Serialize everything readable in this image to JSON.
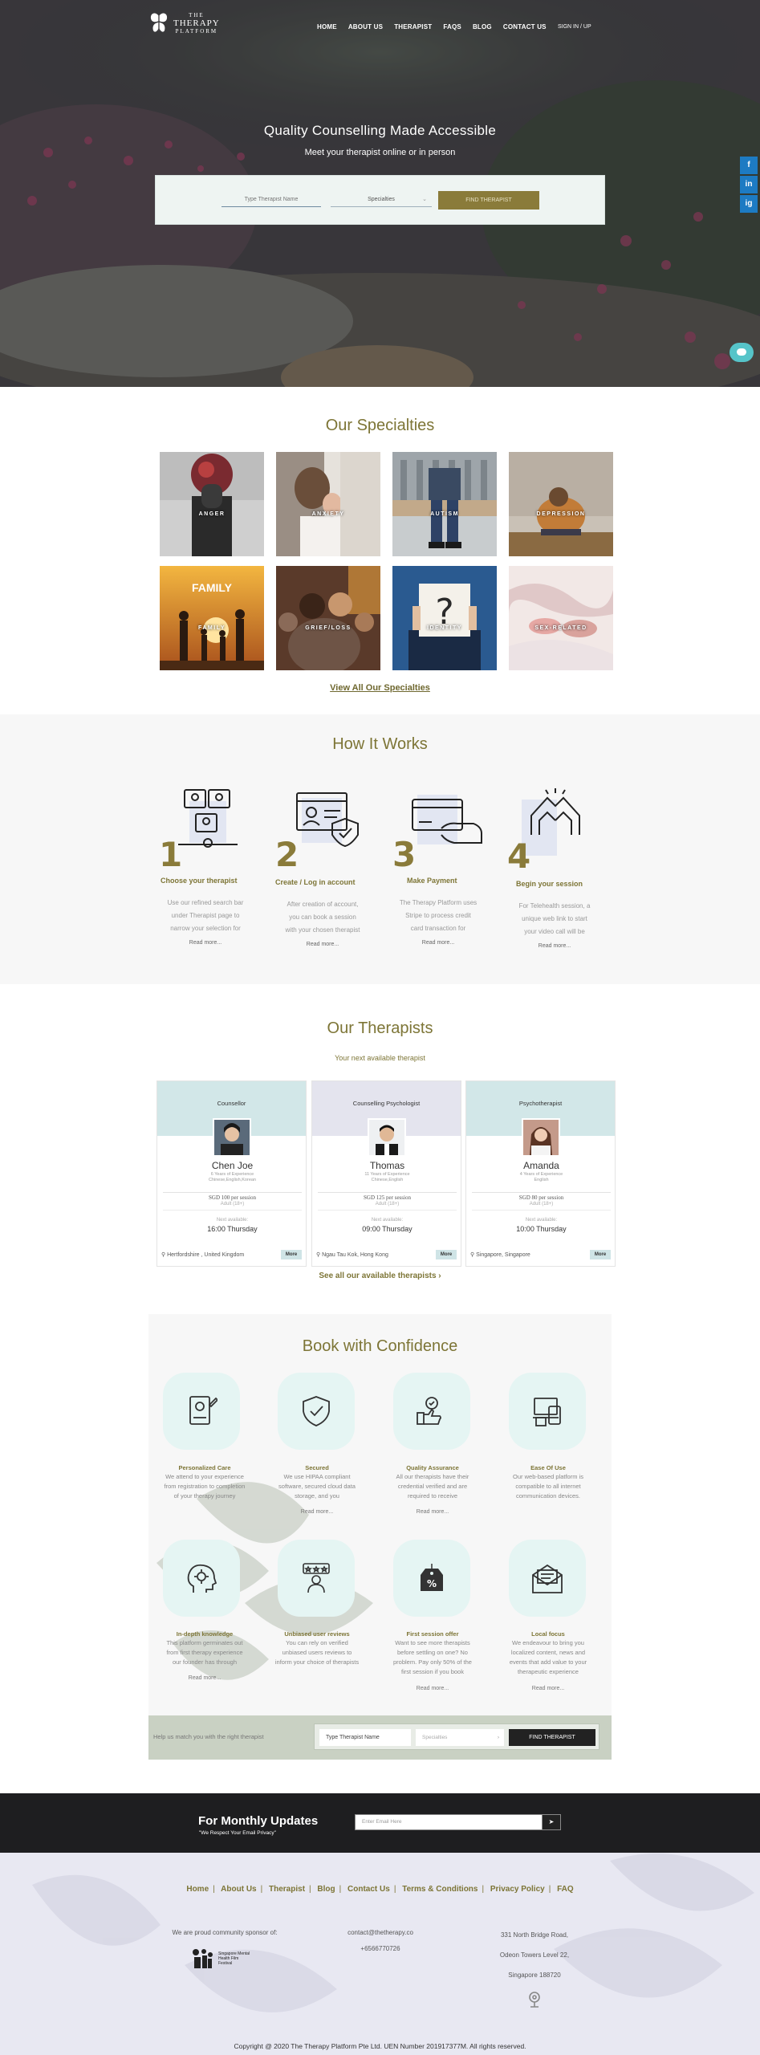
{
  "nav": {
    "logo_small": "THE",
    "logo_big": "THERAPY",
    "logo_sub": "PLATFORM",
    "links": [
      "HOME",
      "ABOUT US",
      "THERAPIST",
      "FAQS",
      "BLOG",
      "CONTACT US"
    ],
    "sign_in": "SIGN IN / UP"
  },
  "hero": {
    "title": "Quality Counselling Made Accessible",
    "subtitle": "Meet your therapist online or in person",
    "search_placeholder": "Type Therapist Name",
    "select_value": "Specialties",
    "button": "FIND THERAPIST"
  },
  "social": [
    "f",
    "in",
    "ig"
  ],
  "specialties": {
    "title": "Our Specialties",
    "items": [
      "ANGER",
      "ANXIETY",
      "AUTISM",
      "DEPRESSION",
      "FAMILY",
      "GRIEF/LOSS",
      "IDENTITY",
      "SEX-RELATED"
    ],
    "family_sign": "FAMILY",
    "view_all": "View All Our Specialties"
  },
  "how": {
    "title": "How It Works",
    "steps": [
      {
        "num": "1",
        "title": "Choose your therapist",
        "lines": [
          "Use our refined search bar",
          "under Therapist page to",
          "narrow your selection for"
        ],
        "more": "Read more..."
      },
      {
        "num": "2",
        "title": "Create / Log in account",
        "lines": [
          "After creation of account,",
          "you can book a session",
          "with your chosen therapist"
        ],
        "more": "Read more..."
      },
      {
        "num": "3",
        "title": "Make Payment",
        "lines": [
          "The Therapy Platform uses",
          "Stripe to process credit",
          "card transaction for"
        ],
        "more": "Read more..."
      },
      {
        "num": "4",
        "title": "Begin your session",
        "lines": [
          "For Telehealth session, a",
          "unique web link to start",
          "your video call will be"
        ],
        "more": "Read more..."
      }
    ]
  },
  "therapists": {
    "title": "Our Therapists",
    "subtitle": "Your next available therapist",
    "cards": [
      {
        "role": "Counsellor",
        "name": "Chen Joe",
        "exp": "6 Years of Experience",
        "lang": "Chinese,English,Korean",
        "price": "SGD 100 per session",
        "adult": "Adult (18+)",
        "next": "Next available:",
        "time": "16:00 Thursday",
        "loc": "Hertfordshire , United Kingdom",
        "more": "More"
      },
      {
        "role": "Counselling Psychologist",
        "name": "Thomas",
        "exp": "11 Years of Experience",
        "lang": "Chinese,English",
        "price": "SGD 125 per session",
        "adult": "Adult (18+)",
        "next": "Next available:",
        "time": "09:00 Thursday",
        "loc": "Ngau Tau Kok, Hong Kong",
        "more": "More"
      },
      {
        "role": "Psychotherapist",
        "name": "Amanda",
        "exp": "4 Years of Experience",
        "lang": "English",
        "price": "SGD 80 per session",
        "adult": "Adult (18+)",
        "next": "Next available:",
        "time": "10:00 Thursday",
        "loc": "Singapore, Singapore",
        "more": "More"
      }
    ],
    "see_all": "See all our available therapists ›"
  },
  "confidence": {
    "title": "Book with Confidence",
    "features": [
      {
        "title": "Personalized Care",
        "lines": [
          "We attend to your experience",
          "from registration to completion",
          "of your therapy journey"
        ],
        "more": ""
      },
      {
        "title": "Secured",
        "lines": [
          "We use HIPAA compliant",
          "software, secured cloud data",
          "storage, and you"
        ],
        "more": "Read more..."
      },
      {
        "title": "Quality Assurance",
        "lines": [
          "All our therapists have their",
          "credential verified and are",
          "required to receive"
        ],
        "more": "Read more..."
      },
      {
        "title": "Ease Of Use",
        "lines": [
          "Our web-based platform is",
          "compatible to all internet",
          "communication devices."
        ],
        "more": ""
      },
      {
        "title": "In-depth knowledge",
        "lines": [
          "This platform germinates out",
          "from first therapy experience",
          "our founder has through"
        ],
        "more": "Read more..."
      },
      {
        "title": "Unbiased user reviews",
        "lines": [
          "You can rely on verified",
          "unbiased users reviews to",
          "inform your choice of therapists"
        ],
        "more": ""
      },
      {
        "title": "First session offer",
        "lines": [
          "Want to see more therapists",
          "before settling on one? No",
          "problem. Pay only 50% of the",
          "first session if you book"
        ],
        "more": "Read more..."
      },
      {
        "title": "Local focus",
        "lines": [
          "We endeavour to bring you",
          "localized content, news and",
          "events that add value to your",
          "therapeutic experience"
        ],
        "more": "Read more..."
      }
    ],
    "bar_text": "Help us match you with the right therapist",
    "bar_input": "Type Therapist Name",
    "bar_select": "Specialties",
    "bar_button": "FIND THERAPIST"
  },
  "newsletter": {
    "title": "For Monthly Updates",
    "subtitle": "\"We Respect Your Email Privacy\"",
    "placeholder": "Enter Email Here",
    "button": "➤"
  },
  "footer": {
    "links": [
      "Home",
      "About Us",
      "Therapist",
      "Blog",
      "Contact Us",
      "Terms & Conditions",
      "Privacy Policy",
      "FAQ"
    ],
    "sponsor": "We are proud community sponsor of:",
    "sponsor_logo": "Singapore Mental Health Film Festival",
    "email": "contact@thetherapy.co",
    "phone": "+6566770726",
    "address": [
      "331 North Bridge Road,",
      "Odeon Towers Level 22,",
      "Singapore 188720"
    ],
    "copyright": "Copyright @ 2020 The Therapy Platform Pte Ltd. UEN Number 201917377M. All rights reserved."
  }
}
